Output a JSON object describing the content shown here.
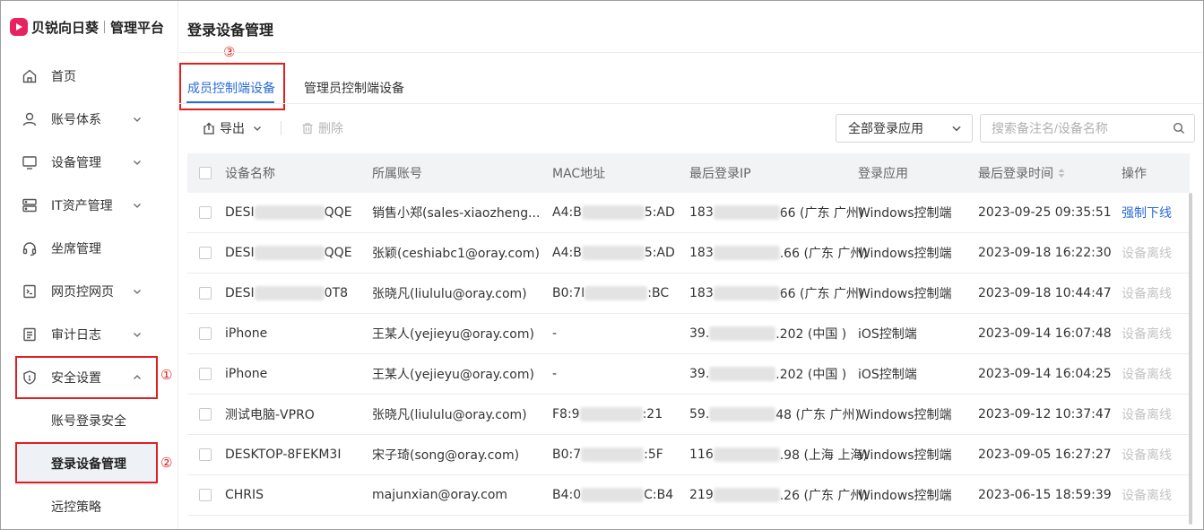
{
  "brand": {
    "name": "贝锐向日葵",
    "sub": "管理平台",
    "color": "#e8225f"
  },
  "sidebar": {
    "items": [
      {
        "label": "首页",
        "icon": "home-icon",
        "has_children": false
      },
      {
        "label": "账号体系",
        "icon": "user-icon",
        "has_children": true
      },
      {
        "label": "设备管理",
        "icon": "monitor-icon",
        "has_children": true
      },
      {
        "label": "IT资产管理",
        "icon": "server-icon",
        "has_children": true
      },
      {
        "label": "坐席管理",
        "icon": "headset-icon",
        "has_children": false
      },
      {
        "label": "网页控网页",
        "icon": "web-terminal-icon",
        "has_children": true
      },
      {
        "label": "审计日志",
        "icon": "log-icon",
        "has_children": true
      },
      {
        "label": "安全设置",
        "icon": "shield-icon",
        "has_children": true,
        "expanded": true
      }
    ],
    "sub_items": [
      {
        "label": "账号登录安全",
        "active": false
      },
      {
        "label": "登录设备管理",
        "active": true
      },
      {
        "label": "远控策略",
        "active": false
      }
    ]
  },
  "annotations": {
    "one": "①",
    "two": "②",
    "three": "③",
    "color": "#e02020"
  },
  "header": {
    "title": "登录设备管理"
  },
  "tabs": [
    {
      "label": "成员控制端设备",
      "active": true
    },
    {
      "label": "管理员控制端设备",
      "active": false
    }
  ],
  "toolbar": {
    "export_label": "导出",
    "delete_label": "删除",
    "app_filter": "全部登录应用",
    "search_placeholder": "搜索备注名/设备名称"
  },
  "table": {
    "columns": [
      "设备名称",
      "所属账号",
      "MAC地址",
      "最后登录IP",
      "登录应用",
      "最后登录时间",
      "操作"
    ],
    "rows": [
      {
        "name_pre": "DESI",
        "name_post": "QQE",
        "account": "销售小郑(sales-xiaozheng...",
        "mac_pre": "A4:B",
        "mac_post": "5:AD",
        "ip_pre": "183",
        "ip_post": "66 (广东 广州)",
        "app": "Windows控制端",
        "time": "2023-09-25 09:35:51",
        "action": "强制下线",
        "online": true
      },
      {
        "name_pre": "DESI",
        "name_post": "QQE",
        "account": "张颖(ceshiabc1@oray.com)",
        "mac_pre": "A4:B",
        "mac_post": "5:AD",
        "ip_pre": "183",
        "ip_post": ".66 (广东 广州)",
        "app": "Windows控制端",
        "time": "2023-09-18 16:22:30",
        "action": "设备离线",
        "online": false
      },
      {
        "name_pre": "DESI",
        "name_post": "0T8",
        "account": "张晓凡(liululu@oray.com)",
        "mac_pre": "B0:7I",
        "mac_post": ":BC",
        "ip_pre": "183",
        "ip_post": "66 (广东 广州)",
        "app": "Windows控制端",
        "time": "2023-09-18 10:44:47",
        "action": "设备离线",
        "online": false
      },
      {
        "name_pre": "iPhone",
        "name_post": "",
        "account": "王某人(yejieyu@oray.com)",
        "mac_pre": "-",
        "mac_post": "",
        "ip_pre": "39.",
        "ip_post": ".202 (中国 )",
        "app": "iOS控制端",
        "time": "2023-09-14 16:07:48",
        "action": "设备离线",
        "online": false
      },
      {
        "name_pre": "iPhone",
        "name_post": "",
        "account": "王某人(yejieyu@oray.com)",
        "mac_pre": "-",
        "mac_post": "",
        "ip_pre": "39.",
        "ip_post": ".202 (中国 )",
        "app": "iOS控制端",
        "time": "2023-09-14 16:04:25",
        "action": "设备离线",
        "online": false
      },
      {
        "name_pre": "测试电脑-VPRO",
        "name_post": "",
        "account": "张晓凡(liululu@oray.com)",
        "mac_pre": "F8:9",
        "mac_post": ":21",
        "ip_pre": "59.",
        "ip_post": "48 (广东 广州)",
        "app": "Windows控制端",
        "time": "2023-09-12 10:37:47",
        "action": "设备离线",
        "online": false
      },
      {
        "name_pre": "DESKTOP-8FEKM3I",
        "name_post": "",
        "account": "宋子琦(song@oray.com)",
        "mac_pre": "B0:7",
        "mac_post": ":5F",
        "ip_pre": "116",
        "ip_post": ".98 (上海 上海)",
        "app": "Windows控制端",
        "time": "2023-09-05 16:27:27",
        "action": "设备离线",
        "online": false
      },
      {
        "name_pre": "CHRIS",
        "name_post": "",
        "account": "majunxian@oray.com",
        "mac_pre": "B4:0",
        "mac_post": "C:B4",
        "ip_pre": "219",
        "ip_post": ".26 (广东 广州)",
        "app": "Windows控制端",
        "time": "2023-06-15 18:59:39",
        "action": "设备离线",
        "online": false
      }
    ]
  }
}
